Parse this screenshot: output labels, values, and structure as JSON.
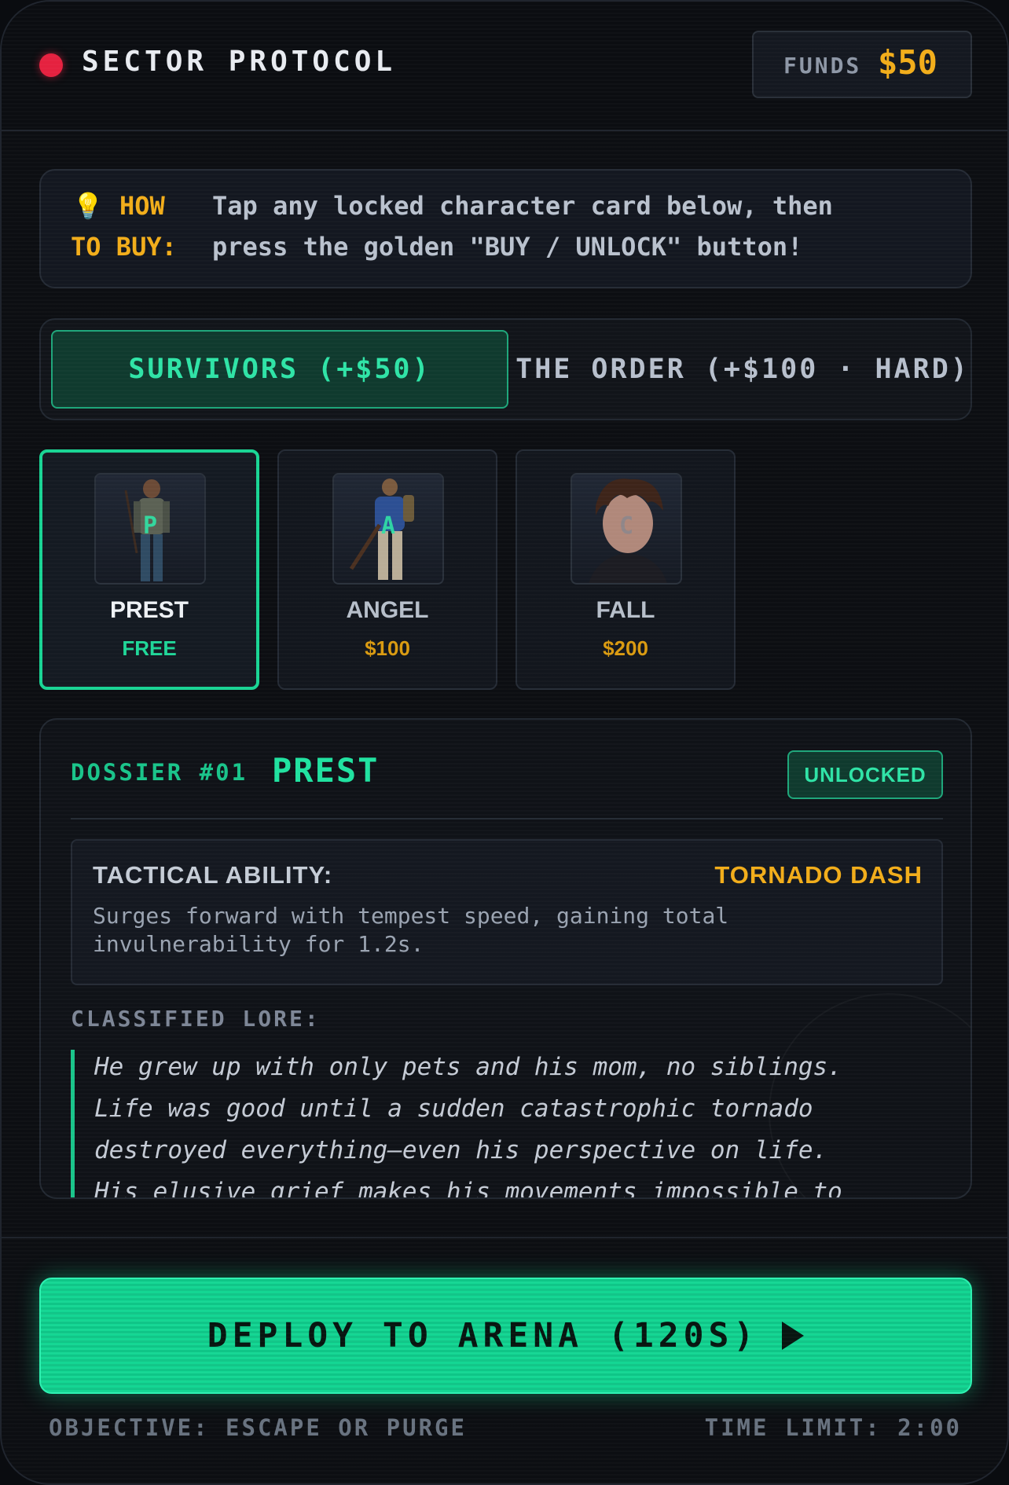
{
  "header": {
    "title": "SECTOR PROTOCOL",
    "funds_label": "FUNDS",
    "funds_value": "$50"
  },
  "howto": {
    "icon": "lightbulb-icon",
    "label_line1": "HOW",
    "label_line2": "TO BUY:",
    "text_line1": "Tap any locked character card below, then",
    "text_line2": "press the golden \"BUY / UNLOCK\" button!"
  },
  "tabs": [
    {
      "label": "SURVIVORS (+$50)",
      "active": true
    },
    {
      "label": "THE ORDER (+$100 · HARD)",
      "active": false
    }
  ],
  "characters": [
    {
      "letter": "P",
      "name": "PREST",
      "price": "FREE",
      "selected": true
    },
    {
      "letter": "A",
      "name": "ANGEL",
      "price": "$100",
      "selected": false
    },
    {
      "letter": "C",
      "name": "FALL",
      "price": "$200",
      "selected": false
    }
  ],
  "dossier": {
    "number_label": "DOSSIER #01",
    "name": "PREST",
    "status": "UNLOCKED",
    "ability_label": "TACTICAL ABILITY:",
    "ability_name": "TORNADO DASH",
    "ability_desc": "Surges forward with tempest speed, gaining total invulnerability for 1.2s.",
    "lore_label": "CLASSIFIED LORE:",
    "lore_lines": [
      "He grew up with only pets and his mom, no siblings.",
      "Life was good until a sudden catastrophic tornado",
      "destroyed everything—even his perspective on life.",
      "His elusive grief makes his movements impossible to"
    ]
  },
  "deploy": {
    "label": "DEPLOY TO ARENA (120S)"
  },
  "footer": {
    "objective": "OBJECTIVE: ESCAPE OR PURGE",
    "time_limit": "TIME LIMIT: 2:00"
  },
  "colors": {
    "accent": "#19d494",
    "gold": "#f2ad1a",
    "alert": "#e5213f",
    "background": "#0c0e12"
  }
}
